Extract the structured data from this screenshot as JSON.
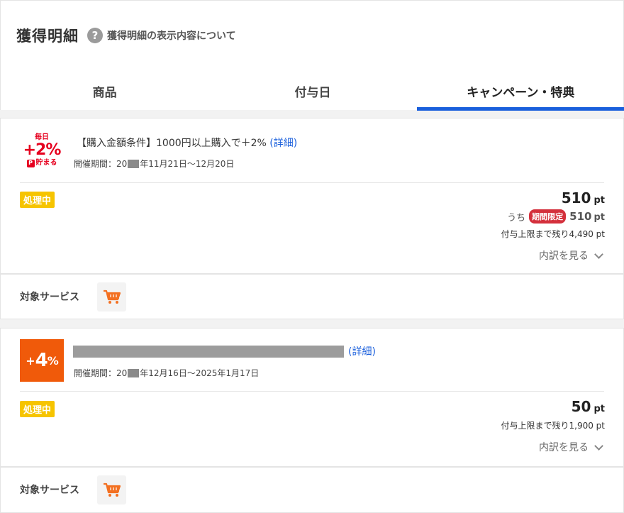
{
  "header": {
    "title": "獲得明細",
    "help_link": "獲得明細の表示内容について"
  },
  "tabs": [
    {
      "label": "商品",
      "active": false
    },
    {
      "label": "付与日",
      "active": false
    },
    {
      "label": "キャンペーン・特典",
      "active": true
    }
  ],
  "campaigns": [
    {
      "badge": {
        "line1": "毎日",
        "line2": "+2%",
        "line3": "貯まる"
      },
      "title": "【購入金額条件】1000円以上購入で＋2%",
      "detail_link": "(詳細)",
      "period_prefix": "開催期間：20",
      "period_suffix": "年11月21日〜12月20日",
      "status": "処理中",
      "points": "510",
      "unit": "pt",
      "limited_prefix": "うち",
      "limited_tag": "期間限定",
      "limited_points": "510",
      "remaining": "付与上限まで残り4,490 pt",
      "detail_toggle": "内訳を見る",
      "service_label": "対象サービス"
    },
    {
      "badge": {
        "plus": "+",
        "num": "4",
        "pct": "%"
      },
      "detail_link": "(詳細)",
      "period_prefix": "開催期間：20",
      "period_suffix": "年12月16日〜2025年1月17日",
      "status": "処理中",
      "points": "50",
      "unit": "pt",
      "remaining": "付与上限まで残り1,900 pt",
      "detail_toggle": "内訳を見る",
      "service_label": "対象サービス"
    }
  ],
  "colors": {
    "accent": "#1a5fdc",
    "status": "#f6c400",
    "limited": "#d4303c",
    "badge4": "#f05a0a",
    "badge2": "#e6001f",
    "cart": "#f37021"
  }
}
